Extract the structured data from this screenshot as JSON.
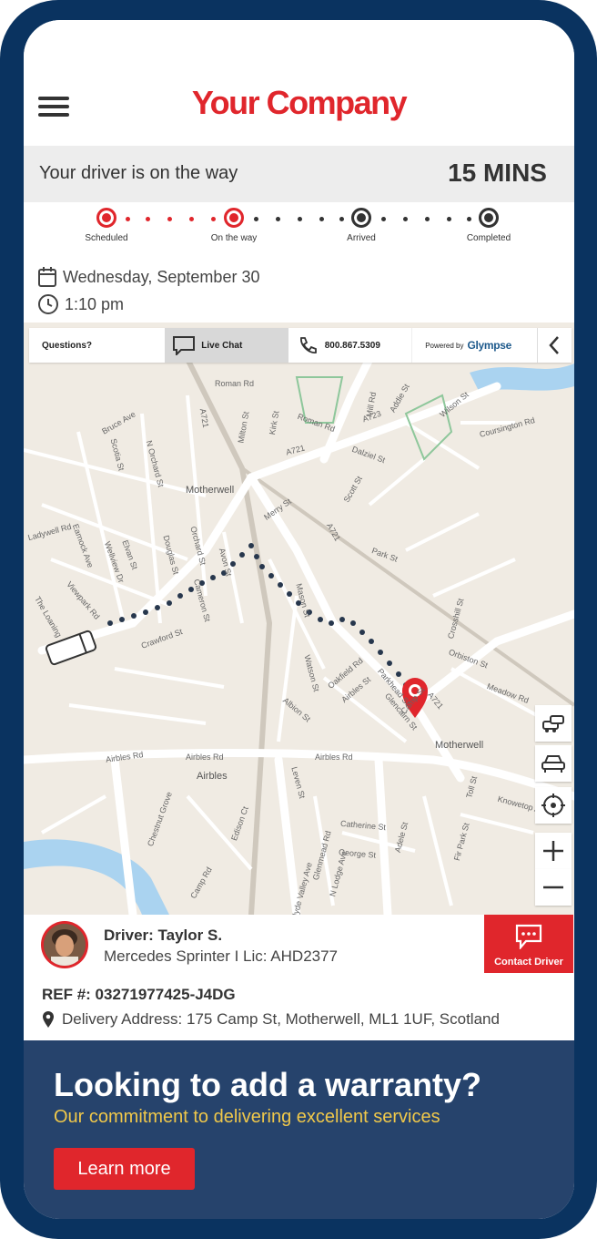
{
  "header": {
    "brand": "Your Company",
    "menu_icon": "hamburger-menu-icon"
  },
  "status": {
    "message": "Your driver is on the way",
    "eta": "15 MINS"
  },
  "progress": {
    "steps": [
      {
        "label": "Scheduled",
        "state": "done"
      },
      {
        "label": "On the way",
        "state": "current"
      },
      {
        "label": "Arrived",
        "state": "pending"
      },
      {
        "label": "Completed",
        "state": "pending"
      }
    ],
    "colors": {
      "done": "#e0262c",
      "pending": "#333333"
    }
  },
  "schedule": {
    "date": "Wednesday, September 30",
    "time": "1:10 pm"
  },
  "map_toolbar": {
    "questions": "Questions?",
    "live_chat": "Live Chat",
    "phone": "800.867.5309",
    "powered_by": "Powered by",
    "provider": "Glympse"
  },
  "map_labels": {
    "motherwell_north": "Motherwell",
    "motherwell_south": "Motherwell",
    "airbles": "Airbles",
    "airbles_rd_1": "Airbles Rd",
    "airbles_rd_2": "Airbles Rd",
    "a721_1": "A721",
    "a721_2": "A721",
    "a721_3": "A721",
    "a723": "A723",
    "merry_st": "Merry St",
    "roman_rd": "Roman Rd",
    "milton_st": "Milton St",
    "kirk_st": "Kirk St",
    "bruce_ave": "Bruce Ave",
    "scotia_st": "Scotia St",
    "orchard_st": "Orchard St",
    "avon_st": "Avon St",
    "douglas_st": "Douglas St",
    "cameron_st": "Cameron St",
    "crawford_st": "Crawford St",
    "mason_st": "Mason St",
    "watson_st": "Watson St",
    "albion_st": "Albion St",
    "oakfield_rd": "Oakfield Rd",
    "airbles_st": "Airbles St",
    "parkhead_st": "Parkhead St",
    "glencairn_st": "Glencairn St",
    "orbiston_st": "Orbiston St",
    "meadow_rd": "Meadow Rd",
    "crosshill_st": "Crosshill St",
    "park_st": "Park St",
    "scott_st": "Scott St",
    "dalziel_st": "Dalziel St",
    "addie_st": "Addie St",
    "mill_rd": "Mill Rd",
    "coursington_rd": "Coursington Rd",
    "wilson_st": "Wilson St",
    "leven_st": "Leven St",
    "catherine_st": "Catherine St",
    "george_st": "George St",
    "adele_st": "Adele St",
    "fir_park_st": "Fir Park St",
    "knowetop_ave": "Knowetop Ave",
    "toll_st": "Toll St",
    "camp_rd": "Camp Rd",
    "edison_ct": "Edison Ct",
    "chestnut_grove": "Chestnut Grove",
    "glenmead_rd": "Glenmead Rd",
    "n_lodge_ave": "N Lodge Ave",
    "clyde_valley_ave": "Clyde Valley Ave",
    "the_loaning": "The Loaning",
    "earnock_ave": "Earnock Ave",
    "viewpark_rd": "Viewpark Rd",
    "wellview_dr": "Wellview Dr",
    "elvan_st": "Elvan St",
    "n_orchard_st": "N Orchard St",
    "ladywell_rd": "Ladywell Rd",
    "camp_st": "Camp St"
  },
  "map_controls": [
    "traffic-icon",
    "car-icon",
    "locate-icon",
    "zoom-in-icon",
    "zoom-out-icon"
  ],
  "driver": {
    "name": "Driver: Taylor S.",
    "vehicle": "Mercedes Sprinter I Lic: AHD2377",
    "contact_label": "Contact Driver"
  },
  "order": {
    "ref": "REF #: 03271977425-J4DG",
    "address": "Delivery Address: 175 Camp St, Motherwell, ML1 1UF, Scotland"
  },
  "banner": {
    "title": "Looking to add a warranty?",
    "subtitle": "Our commitment to delivering excellent services",
    "button": "Learn more"
  },
  "colors": {
    "brand": "#e0262c",
    "frame": "#0a3360",
    "banner_bg": "#26436c",
    "banner_sub": "#f0c84a"
  }
}
